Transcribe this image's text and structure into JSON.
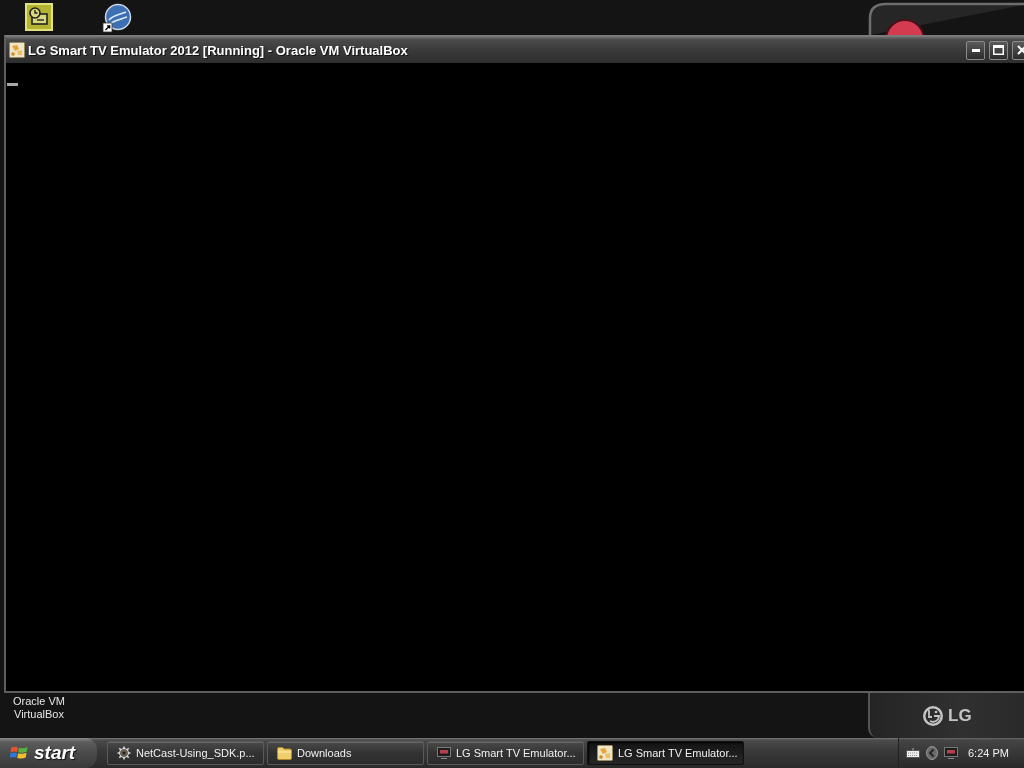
{
  "desktop": {
    "shortcut_label": "Oracle VM VirtualBox",
    "wallpaper_logo": "LG"
  },
  "window": {
    "title": "LG Smart TV Emulator 2012 [Running] - Oracle VM VirtualBox"
  },
  "taskbar": {
    "start": "start",
    "tasks": [
      {
        "label": "NetCast-Using_SDK.p...",
        "kind": "document",
        "selected": false
      },
      {
        "label": "Downloads",
        "kind": "folder",
        "selected": false
      },
      {
        "label": "LG Smart TV Emulator...",
        "kind": "emulator",
        "selected": false
      },
      {
        "label": "LG Smart TV Emulator...",
        "kind": "vm",
        "selected": true
      }
    ],
    "clock": "6:24 PM"
  }
}
